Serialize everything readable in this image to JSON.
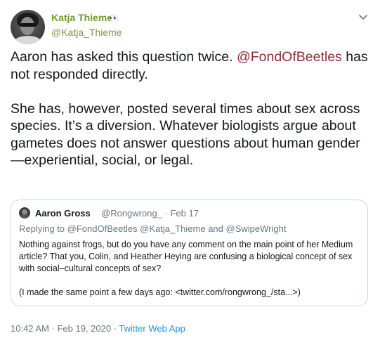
{
  "author": {
    "name": "Katja Thieme",
    "emoji": "👀",
    "handle": "@Katja_Thieme"
  },
  "tweet": {
    "p1_before": "Aaron has asked this question twice. ",
    "p1_mention": "@FondOfBeetles",
    "p1_after": " has not responded directly.",
    "p2": "She has, however, posted several times about sex across species. It’s a diversion. Whatever biologists argue about gametes does not answer questions about human gender—experiential, social, or legal."
  },
  "quote": {
    "name": "Aaron Gross",
    "handle_date": "@Rongwrong_ · Feb 17",
    "reply_prefix": "Replying to ",
    "reply_to": "@FondOfBeetles @Katja_Thieme",
    "reply_and": " and ",
    "reply_last": "@SwipeWright",
    "text1": "Nothing against frogs, but do you have any comment on the main point of her Medium article? That you, Colin, and Heather Heying are confusing a biological concept of sex with social–cultural concepts of sex?",
    "text2": "(I made the same point a few days ago: <twitter.com/rongwrong_/sta...>)"
  },
  "meta": {
    "timestamp": "10:42 AM · Feb 19, 2020 · ",
    "source": "Twitter Web App"
  },
  "icons": {
    "caret": "chevron-down-icon"
  },
  "colors": {
    "name": "#6f9a2d",
    "mention": "#8f2e34",
    "source_link": "#1b95e0",
    "secondary_text": "#657786",
    "border": "#ccd6dd"
  }
}
